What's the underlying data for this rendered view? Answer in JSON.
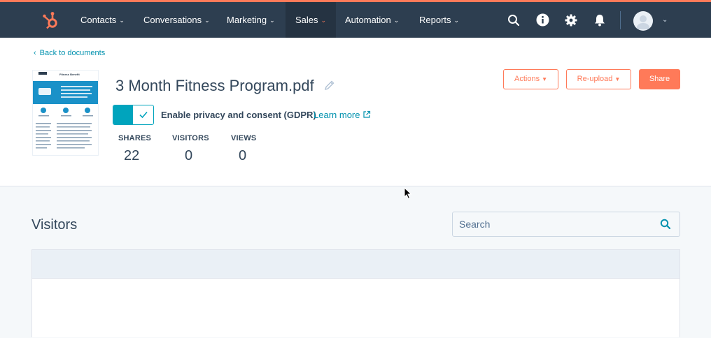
{
  "nav": {
    "items": [
      {
        "label": "Contacts"
      },
      {
        "label": "Conversations"
      },
      {
        "label": "Marketing"
      },
      {
        "label": "Sales"
      },
      {
        "label": "Automation"
      },
      {
        "label": "Reports"
      }
    ],
    "active": "Sales",
    "icons": [
      "search-icon",
      "info-icon",
      "gear-icon",
      "bell-icon"
    ]
  },
  "document": {
    "back_link": "Back to documents",
    "title": "3 Month Fitness Program.pdf",
    "thumbnail_heading": "Fitness Benefit",
    "gdpr_label": "Enable privacy and consent (GDPR)",
    "gdpr_enabled": true,
    "learn_more": "Learn more",
    "stats": [
      {
        "label": "SHARES",
        "value": "22"
      },
      {
        "label": "VISITORS",
        "value": "0"
      },
      {
        "label": "VIEWS",
        "value": "0"
      }
    ]
  },
  "actions": {
    "actions_label": "Actions",
    "reupload_label": "Re-upload",
    "share_label": "Share"
  },
  "visitors": {
    "title": "Visitors",
    "search_placeholder": "Search"
  },
  "colors": {
    "nav_bg": "#2d3e50",
    "accent": "#ff7a59",
    "teal": "#00a4bd",
    "link": "#0091ae"
  }
}
